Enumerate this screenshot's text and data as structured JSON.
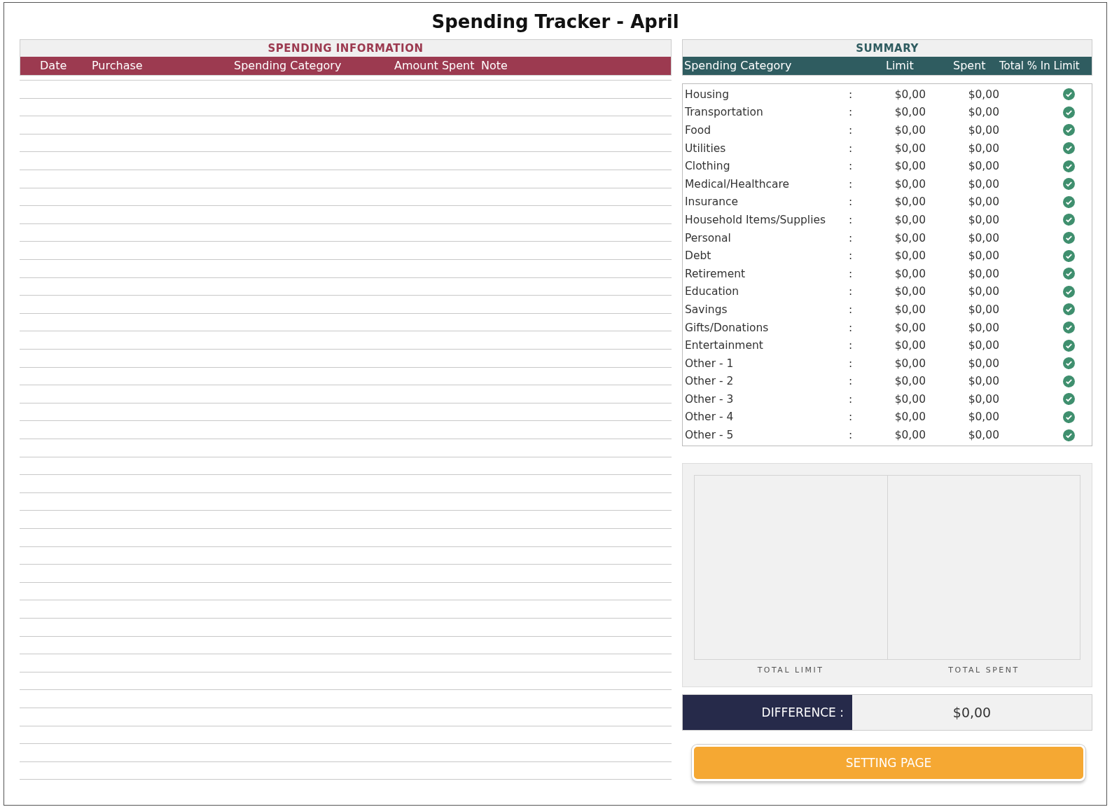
{
  "title": "Spending Tracker - April",
  "spending_information": {
    "heading": "SPENDING INFORMATION",
    "columns": [
      "Date",
      "Purchase",
      "Spending Category",
      "Amount Spent",
      "Note"
    ]
  },
  "summary": {
    "heading": "SUMMARY",
    "columns": [
      "Spending Category",
      "Limit",
      "Spent",
      "Total % In Limit"
    ],
    "rows": [
      {
        "category": "Housing",
        "separator": ":",
        "limit": "$0,00",
        "spent": "$0,00",
        "in_limit": true
      },
      {
        "category": "Transportation",
        "separator": ":",
        "limit": "$0,00",
        "spent": "$0,00",
        "in_limit": true
      },
      {
        "category": "Food",
        "separator": ":",
        "limit": "$0,00",
        "spent": "$0,00",
        "in_limit": true
      },
      {
        "category": "Utilities",
        "separator": ":",
        "limit": "$0,00",
        "spent": "$0,00",
        "in_limit": true
      },
      {
        "category": "Clothing",
        "separator": ":",
        "limit": "$0,00",
        "spent": "$0,00",
        "in_limit": true
      },
      {
        "category": "Medical/Healthcare",
        "separator": ":",
        "limit": "$0,00",
        "spent": "$0,00",
        "in_limit": true
      },
      {
        "category": "Insurance",
        "separator": ":",
        "limit": "$0,00",
        "spent": "$0,00",
        "in_limit": true
      },
      {
        "category": "Household Items/Supplies",
        "separator": ":",
        "limit": "$0,00",
        "spent": "$0,00",
        "in_limit": true
      },
      {
        "category": "Personal",
        "separator": ":",
        "limit": "$0,00",
        "spent": "$0,00",
        "in_limit": true
      },
      {
        "category": "Debt",
        "separator": ":",
        "limit": "$0,00",
        "spent": "$0,00",
        "in_limit": true
      },
      {
        "category": "Retirement",
        "separator": ":",
        "limit": "$0,00",
        "spent": "$0,00",
        "in_limit": true
      },
      {
        "category": "Education",
        "separator": ":",
        "limit": "$0,00",
        "spent": "$0,00",
        "in_limit": true
      },
      {
        "category": "Savings",
        "separator": ":",
        "limit": "$0,00",
        "spent": "$0,00",
        "in_limit": true
      },
      {
        "category": "Gifts/Donations",
        "separator": ":",
        "limit": "$0,00",
        "spent": "$0,00",
        "in_limit": true
      },
      {
        "category": "Entertainment",
        "separator": ":",
        "limit": "$0,00",
        "spent": "$0,00",
        "in_limit": true
      },
      {
        "category": "Other - 1",
        "separator": ":",
        "limit": "$0,00",
        "spent": "$0,00",
        "in_limit": true
      },
      {
        "category": "Other - 2",
        "separator": ":",
        "limit": "$0,00",
        "spent": "$0,00",
        "in_limit": true
      },
      {
        "category": "Other - 3",
        "separator": ":",
        "limit": "$0,00",
        "spent": "$0,00",
        "in_limit": true
      },
      {
        "category": "Other - 4",
        "separator": ":",
        "limit": "$0,00",
        "spent": "$0,00",
        "in_limit": true
      },
      {
        "category": "Other - 5",
        "separator": ":",
        "limit": "$0,00",
        "spent": "$0,00",
        "in_limit": true
      }
    ]
  },
  "chart": {
    "labels": [
      "TOTAL LIMIT",
      "TOTAL SPENT"
    ]
  },
  "difference": {
    "label": "DIFFERENCE :",
    "value": "$0,00"
  },
  "setting_button": "SETTING PAGE"
}
